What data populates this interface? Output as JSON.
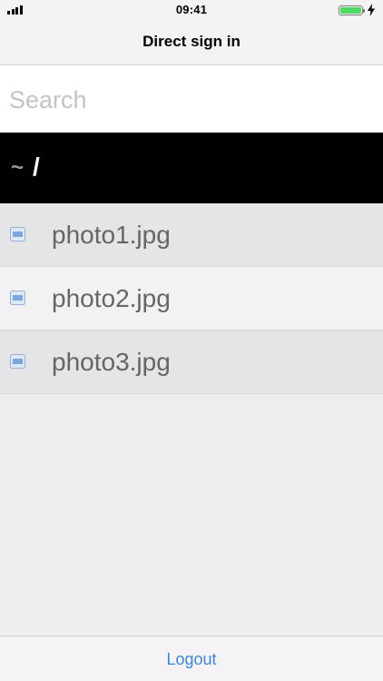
{
  "status_bar": {
    "time": "09:41"
  },
  "nav": {
    "title": "Direct sign in"
  },
  "search": {
    "placeholder": "Search",
    "value": ""
  },
  "path": {
    "home": "~",
    "current": "/"
  },
  "files": [
    {
      "name": "photo1.jpg",
      "icon": "image-file-icon"
    },
    {
      "name": "photo2.jpg",
      "icon": "image-file-icon"
    },
    {
      "name": "photo3.jpg",
      "icon": "image-file-icon"
    }
  ],
  "toolbar": {
    "logout_label": "Logout"
  },
  "colors": {
    "accent": "#3a86d0",
    "battery": "#4cd964",
    "path_bar": "#000000"
  }
}
